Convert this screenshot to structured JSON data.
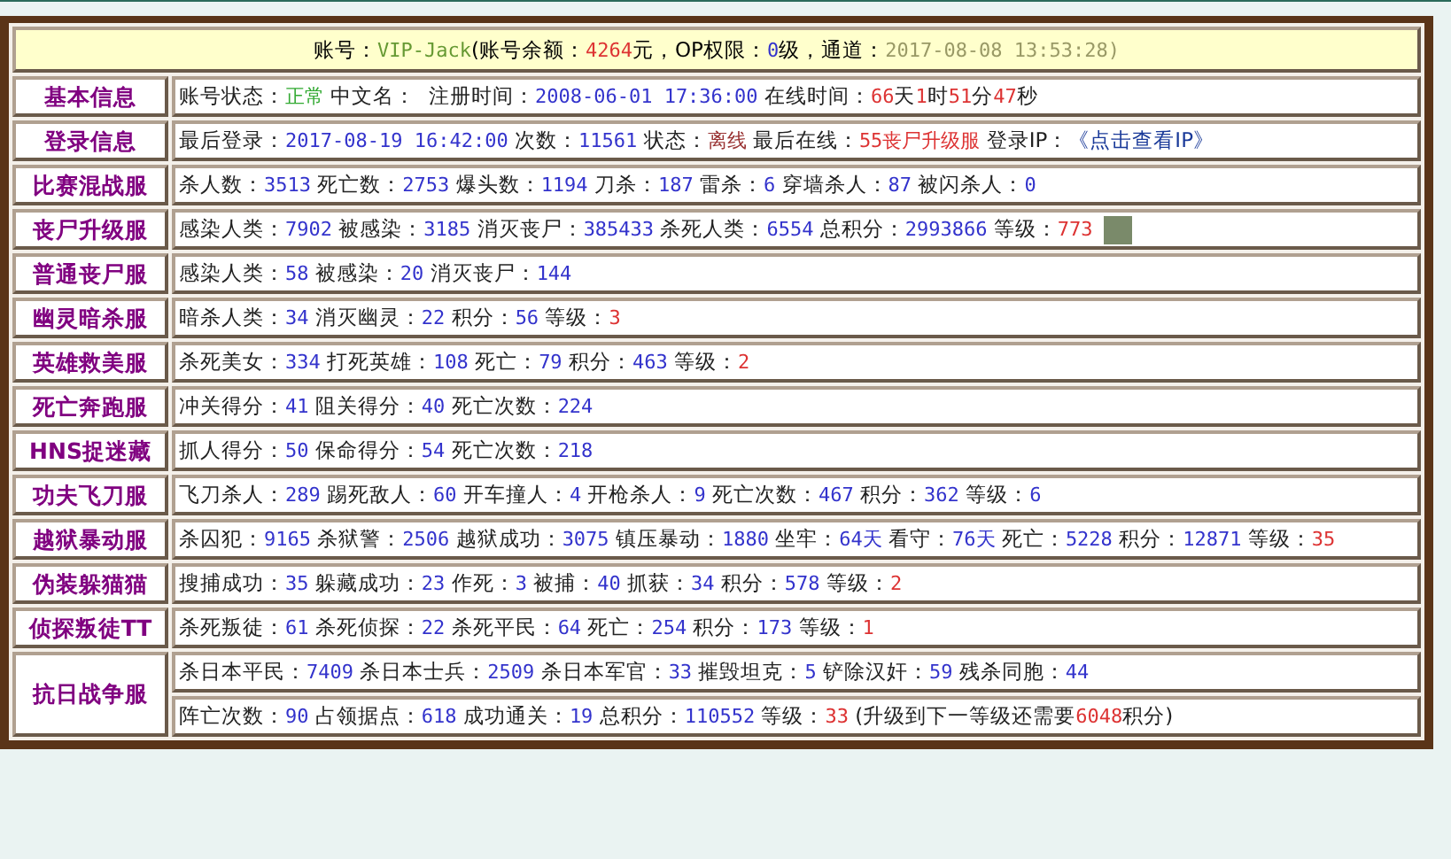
{
  "header": [
    {
      "kind": "text",
      "text": "账号："
    },
    {
      "kind": "value",
      "text": "VIP-Jack",
      "color": "#669933"
    },
    {
      "kind": "text",
      "text": "(账号余额："
    },
    {
      "kind": "value",
      "text": "4264",
      "color": "#dd3333"
    },
    {
      "kind": "text",
      "text": "元，OP权限："
    },
    {
      "kind": "value",
      "text": "0",
      "color": "#3333cc"
    },
    {
      "kind": "text",
      "text": "级，通道："
    },
    {
      "kind": "value",
      "text": "2017-08-08 13:53:28)",
      "color": "#999966"
    }
  ],
  "rows": [
    {
      "label": "基本信息",
      "lines": [
        [
          {
            "kind": "text",
            "text": "账号状态："
          },
          {
            "kind": "value",
            "text": "正常",
            "color": "#33aa33"
          },
          {
            "kind": "text",
            "text": " 中文名：  注册时间："
          },
          {
            "kind": "value",
            "text": "2008-06-01 17:36:00",
            "color": "#3333cc"
          },
          {
            "kind": "text",
            "text": " 在线时间："
          },
          {
            "kind": "value",
            "text": "66",
            "color": "#dd3333"
          },
          {
            "kind": "text",
            "text": "天"
          },
          {
            "kind": "value",
            "text": "1",
            "color": "#dd3333"
          },
          {
            "kind": "text",
            "text": "时"
          },
          {
            "kind": "value",
            "text": "51",
            "color": "#dd3333"
          },
          {
            "kind": "text",
            "text": "分"
          },
          {
            "kind": "value",
            "text": "47",
            "color": "#dd3333"
          },
          {
            "kind": "text",
            "text": "秒"
          }
        ]
      ]
    },
    {
      "label": "登录信息",
      "lines": [
        [
          {
            "kind": "text",
            "text": "最后登录："
          },
          {
            "kind": "value",
            "text": "2017-08-19 16:42:00",
            "color": "#3333cc"
          },
          {
            "kind": "text",
            "text": " 次数："
          },
          {
            "kind": "value",
            "text": "11561",
            "color": "#3333cc"
          },
          {
            "kind": "text",
            "text": " 状态："
          },
          {
            "kind": "value",
            "text": "离线",
            "color": "#993333"
          },
          {
            "kind": "text",
            "text": " 最后在线："
          },
          {
            "kind": "value",
            "text": "55丧尸升级服",
            "color": "#dd3333"
          },
          {
            "kind": "text",
            "text": " 登录IP："
          },
          {
            "kind": "link",
            "text": "《点击查看IP》"
          }
        ]
      ]
    },
    {
      "label": "比赛混战服",
      "lines": [
        [
          {
            "kind": "text",
            "text": "杀人数："
          },
          {
            "kind": "value",
            "text": "3513",
            "color": "#3333cc"
          },
          {
            "kind": "text",
            "text": " 死亡数："
          },
          {
            "kind": "value",
            "text": "2753",
            "color": "#3333cc"
          },
          {
            "kind": "text",
            "text": " 爆头数："
          },
          {
            "kind": "value",
            "text": "1194",
            "color": "#3333cc"
          },
          {
            "kind": "text",
            "text": " 刀杀："
          },
          {
            "kind": "value",
            "text": "187",
            "color": "#3333cc"
          },
          {
            "kind": "text",
            "text": " 雷杀："
          },
          {
            "kind": "value",
            "text": "6",
            "color": "#3333cc"
          },
          {
            "kind": "text",
            "text": " 穿墙杀人："
          },
          {
            "kind": "value",
            "text": "87",
            "color": "#3333cc"
          },
          {
            "kind": "text",
            "text": " 被闪杀人："
          },
          {
            "kind": "value",
            "text": "0",
            "color": "#3333cc"
          }
        ]
      ]
    },
    {
      "label": "丧尸升级服",
      "lines": [
        [
          {
            "kind": "text",
            "text": "感染人类："
          },
          {
            "kind": "value",
            "text": "7902",
            "color": "#3333cc"
          },
          {
            "kind": "text",
            "text": " 被感染："
          },
          {
            "kind": "value",
            "text": "3185",
            "color": "#3333cc"
          },
          {
            "kind": "text",
            "text": " 消灭丧尸："
          },
          {
            "kind": "value",
            "text": "385433",
            "color": "#3333cc"
          },
          {
            "kind": "text",
            "text": " 杀死人类："
          },
          {
            "kind": "value",
            "text": "6554",
            "color": "#3333cc"
          },
          {
            "kind": "text",
            "text": " 总积分："
          },
          {
            "kind": "value",
            "text": "2993866",
            "color": "#3333cc"
          },
          {
            "kind": "text",
            "text": " 等级："
          },
          {
            "kind": "value",
            "text": "773",
            "color": "#dd3333"
          },
          {
            "kind": "photo"
          }
        ]
      ]
    },
    {
      "label": "普通丧尸服",
      "lines": [
        [
          {
            "kind": "text",
            "text": "感染人类："
          },
          {
            "kind": "value",
            "text": "58",
            "color": "#3333cc"
          },
          {
            "kind": "text",
            "text": " 被感染："
          },
          {
            "kind": "value",
            "text": "20",
            "color": "#3333cc"
          },
          {
            "kind": "text",
            "text": " 消灭丧尸："
          },
          {
            "kind": "value",
            "text": "144",
            "color": "#3333cc"
          }
        ]
      ]
    },
    {
      "label": "幽灵暗杀服",
      "lines": [
        [
          {
            "kind": "text",
            "text": "暗杀人类："
          },
          {
            "kind": "value",
            "text": "34",
            "color": "#3333cc"
          },
          {
            "kind": "text",
            "text": " 消灭幽灵："
          },
          {
            "kind": "value",
            "text": "22",
            "color": "#3333cc"
          },
          {
            "kind": "text",
            "text": " 积分："
          },
          {
            "kind": "value",
            "text": "56",
            "color": "#3333cc"
          },
          {
            "kind": "text",
            "text": " 等级："
          },
          {
            "kind": "value",
            "text": "3",
            "color": "#dd3333"
          }
        ]
      ]
    },
    {
      "label": "英雄救美服",
      "lines": [
        [
          {
            "kind": "text",
            "text": "杀死美女："
          },
          {
            "kind": "value",
            "text": "334",
            "color": "#3333cc"
          },
          {
            "kind": "text",
            "text": " 打死英雄："
          },
          {
            "kind": "value",
            "text": "108",
            "color": "#3333cc"
          },
          {
            "kind": "text",
            "text": " 死亡："
          },
          {
            "kind": "value",
            "text": "79",
            "color": "#3333cc"
          },
          {
            "kind": "text",
            "text": " 积分："
          },
          {
            "kind": "value",
            "text": "463",
            "color": "#3333cc"
          },
          {
            "kind": "text",
            "text": " 等级："
          },
          {
            "kind": "value",
            "text": "2",
            "color": "#dd3333"
          }
        ]
      ]
    },
    {
      "label": "死亡奔跑服",
      "lines": [
        [
          {
            "kind": "text",
            "text": "冲关得分："
          },
          {
            "kind": "value",
            "text": "41",
            "color": "#3333cc"
          },
          {
            "kind": "text",
            "text": " 阻关得分："
          },
          {
            "kind": "value",
            "text": "40",
            "color": "#3333cc"
          },
          {
            "kind": "text",
            "text": " 死亡次数："
          },
          {
            "kind": "value",
            "text": "224",
            "color": "#3333cc"
          }
        ]
      ]
    },
    {
      "label": "HNS捉迷藏",
      "lines": [
        [
          {
            "kind": "text",
            "text": "抓人得分："
          },
          {
            "kind": "value",
            "text": "50",
            "color": "#3333cc"
          },
          {
            "kind": "text",
            "text": " 保命得分："
          },
          {
            "kind": "value",
            "text": "54",
            "color": "#3333cc"
          },
          {
            "kind": "text",
            "text": " 死亡次数："
          },
          {
            "kind": "value",
            "text": "218",
            "color": "#3333cc"
          }
        ]
      ]
    },
    {
      "label": "功夫飞刀服",
      "lines": [
        [
          {
            "kind": "text",
            "text": "飞刀杀人："
          },
          {
            "kind": "value",
            "text": "289",
            "color": "#3333cc"
          },
          {
            "kind": "text",
            "text": " 踢死敌人："
          },
          {
            "kind": "value",
            "text": "60",
            "color": "#3333cc"
          },
          {
            "kind": "text",
            "text": " 开车撞人："
          },
          {
            "kind": "value",
            "text": "4",
            "color": "#3333cc"
          },
          {
            "kind": "text",
            "text": " 开枪杀人："
          },
          {
            "kind": "value",
            "text": "9",
            "color": "#3333cc"
          },
          {
            "kind": "text",
            "text": " 死亡次数："
          },
          {
            "kind": "value",
            "text": "467",
            "color": "#3333cc"
          },
          {
            "kind": "text",
            "text": " 积分："
          },
          {
            "kind": "value",
            "text": "362",
            "color": "#3333cc"
          },
          {
            "kind": "text",
            "text": " 等级："
          },
          {
            "kind": "value",
            "text": "6",
            "color": "#3333cc"
          }
        ]
      ]
    },
    {
      "label": "越狱暴动服",
      "lines": [
        [
          {
            "kind": "text",
            "text": "杀囚犯："
          },
          {
            "kind": "value",
            "text": "9165",
            "color": "#3333cc"
          },
          {
            "kind": "text",
            "text": " 杀狱警："
          },
          {
            "kind": "value",
            "text": "2506",
            "color": "#3333cc"
          },
          {
            "kind": "text",
            "text": " 越狱成功："
          },
          {
            "kind": "value",
            "text": "3075",
            "color": "#3333cc"
          },
          {
            "kind": "text",
            "text": " 镇压暴动："
          },
          {
            "kind": "value",
            "text": "1880",
            "color": "#3333cc"
          },
          {
            "kind": "text",
            "text": " 坐牢："
          },
          {
            "kind": "value",
            "text": "64天",
            "color": "#3333cc"
          },
          {
            "kind": "text",
            "text": " 看守："
          },
          {
            "kind": "value",
            "text": "76天",
            "color": "#3333cc"
          },
          {
            "kind": "text",
            "text": " 死亡："
          },
          {
            "kind": "value",
            "text": "5228",
            "color": "#3333cc"
          },
          {
            "kind": "text",
            "text": " 积分："
          },
          {
            "kind": "value",
            "text": "12871",
            "color": "#3333cc"
          },
          {
            "kind": "text",
            "text": " 等级："
          },
          {
            "kind": "value",
            "text": "35",
            "color": "#dd3333"
          }
        ]
      ]
    },
    {
      "label": "伪装躲猫猫",
      "lines": [
        [
          {
            "kind": "text",
            "text": "搜捕成功："
          },
          {
            "kind": "value",
            "text": "35",
            "color": "#3333cc"
          },
          {
            "kind": "text",
            "text": " 躲藏成功："
          },
          {
            "kind": "value",
            "text": "23",
            "color": "#3333cc"
          },
          {
            "kind": "text",
            "text": " 作死："
          },
          {
            "kind": "value",
            "text": "3",
            "color": "#3333cc"
          },
          {
            "kind": "text",
            "text": " 被捕："
          },
          {
            "kind": "value",
            "text": "40",
            "color": "#3333cc"
          },
          {
            "kind": "text",
            "text": " 抓获："
          },
          {
            "kind": "value",
            "text": "34",
            "color": "#3333cc"
          },
          {
            "kind": "text",
            "text": " 积分："
          },
          {
            "kind": "value",
            "text": "578",
            "color": "#3333cc"
          },
          {
            "kind": "text",
            "text": " 等级："
          },
          {
            "kind": "value",
            "text": "2",
            "color": "#dd3333"
          }
        ]
      ]
    },
    {
      "label": "侦探叛徒TT",
      "lines": [
        [
          {
            "kind": "text",
            "text": "杀死叛徒："
          },
          {
            "kind": "value",
            "text": "61",
            "color": "#3333cc"
          },
          {
            "kind": "text",
            "text": " 杀死侦探："
          },
          {
            "kind": "value",
            "text": "22",
            "color": "#3333cc"
          },
          {
            "kind": "text",
            "text": " 杀死平民："
          },
          {
            "kind": "value",
            "text": "64",
            "color": "#3333cc"
          },
          {
            "kind": "text",
            "text": " 死亡："
          },
          {
            "kind": "value",
            "text": "254",
            "color": "#3333cc"
          },
          {
            "kind": "text",
            "text": " 积分："
          },
          {
            "kind": "value",
            "text": "173",
            "color": "#3333cc"
          },
          {
            "kind": "text",
            "text": " 等级："
          },
          {
            "kind": "value",
            "text": "1",
            "color": "#dd3333"
          }
        ]
      ]
    },
    {
      "label": "抗日战争服",
      "lines": [
        [
          {
            "kind": "text",
            "text": "杀日本平民："
          },
          {
            "kind": "value",
            "text": "7409",
            "color": "#3333cc"
          },
          {
            "kind": "text",
            "text": " 杀日本士兵："
          },
          {
            "kind": "value",
            "text": "2509",
            "color": "#3333cc"
          },
          {
            "kind": "text",
            "text": " 杀日本军官："
          },
          {
            "kind": "value",
            "text": "33",
            "color": "#3333cc"
          },
          {
            "kind": "text",
            "text": " 摧毁坦克："
          },
          {
            "kind": "value",
            "text": "5",
            "color": "#3333cc"
          },
          {
            "kind": "text",
            "text": " 铲除汉奸："
          },
          {
            "kind": "value",
            "text": "59",
            "color": "#3333cc"
          },
          {
            "kind": "text",
            "text": " 残杀同胞："
          },
          {
            "kind": "value",
            "text": "44",
            "color": "#3333cc"
          }
        ],
        [
          {
            "kind": "text",
            "text": "阵亡次数："
          },
          {
            "kind": "value",
            "text": "90",
            "color": "#3333cc"
          },
          {
            "kind": "text",
            "text": " 占领据点："
          },
          {
            "kind": "value",
            "text": "618",
            "color": "#3333cc"
          },
          {
            "kind": "text",
            "text": " 成功通关："
          },
          {
            "kind": "value",
            "text": "19",
            "color": "#3333cc"
          },
          {
            "kind": "text",
            "text": " 总积分："
          },
          {
            "kind": "value",
            "text": "110552",
            "color": "#3333cc"
          },
          {
            "kind": "text",
            "text": " 等级："
          },
          {
            "kind": "value",
            "text": "33",
            "color": "#dd3333"
          },
          {
            "kind": "text",
            "text": " (升级到下一等级还需要"
          },
          {
            "kind": "value",
            "text": "6048",
            "color": "#dd3333"
          },
          {
            "kind": "text",
            "text": "积分)"
          }
        ]
      ]
    }
  ]
}
